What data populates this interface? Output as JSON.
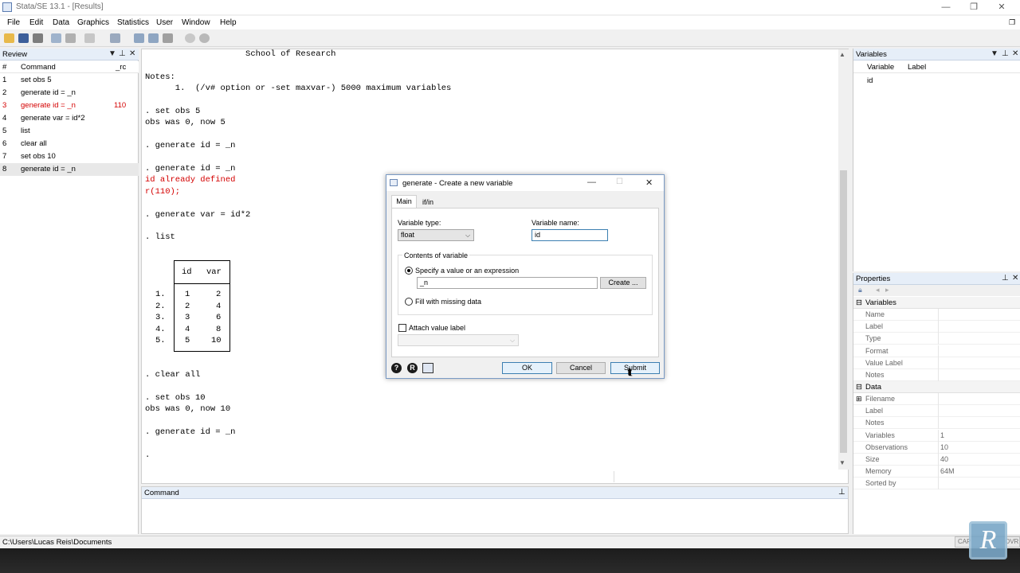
{
  "window": {
    "title": "Stata/SE 13.1 - [Results]",
    "controls": {
      "minimize": "—",
      "restore": "❐",
      "close": "✕"
    }
  },
  "menu": [
    "File",
    "Edit",
    "Data",
    "Graphics",
    "Statistics",
    "User",
    "Window",
    "Help"
  ],
  "review": {
    "title": "Review",
    "col_num": "#",
    "col_command": "Command",
    "col_rc": "_rc",
    "rows": [
      {
        "num": "1",
        "command": "set obs 5",
        "rc": ""
      },
      {
        "num": "2",
        "command": "generate id = _n",
        "rc": ""
      },
      {
        "num": "3",
        "command": "generate id = _n",
        "rc": "110"
      },
      {
        "num": "4",
        "command": "generate var = id*2",
        "rc": ""
      },
      {
        "num": "5",
        "command": "list",
        "rc": ""
      },
      {
        "num": "6",
        "command": "clear all",
        "rc": ""
      },
      {
        "num": "7",
        "command": "set obs 10",
        "rc": ""
      },
      {
        "num": "8",
        "command": "generate id = _n",
        "rc": ""
      }
    ]
  },
  "results": {
    "lines": [
      "                    School of Research",
      "",
      "Notes:",
      "      1.  (/v# option or -set maxvar-) 5000 maximum variables",
      "",
      ". set obs 5",
      "obs was 0, now 5",
      "",
      ". generate id = _n",
      "",
      ". generate id = _n",
      "id already defined",
      "r(110);",
      "",
      ". generate var = id*2",
      "",
      ". list"
    ],
    "list_header": [
      "id",
      "var"
    ],
    "list_rows": [
      {
        "obs": "1.",
        "id": "1",
        "var": "2"
      },
      {
        "obs": "2.",
        "id": "2",
        "var": "4"
      },
      {
        "obs": "3.",
        "id": "3",
        "var": "6"
      },
      {
        "obs": "4.",
        "id": "4",
        "var": "8"
      },
      {
        "obs": "5.",
        "id": "5",
        "var": "10"
      }
    ],
    "tail_lines": [
      ". clear all",
      "",
      ". set obs 10",
      "obs was 0, now 10",
      "",
      ". generate id = _n",
      "",
      "."
    ]
  },
  "command_pane": {
    "title": "Command"
  },
  "variables": {
    "title": "Variables",
    "col_variable": "Variable",
    "col_label": "Label",
    "rows": [
      {
        "name": "id",
        "label": ""
      }
    ]
  },
  "properties": {
    "title": "Properties",
    "variables_section": "Variables",
    "variables_fields": [
      {
        "label": "Name",
        "value": ""
      },
      {
        "label": "Label",
        "value": ""
      },
      {
        "label": "Type",
        "value": ""
      },
      {
        "label": "Format",
        "value": ""
      },
      {
        "label": "Value Label",
        "value": ""
      },
      {
        "label": "Notes",
        "value": ""
      }
    ],
    "data_section": "Data",
    "data_fields": [
      {
        "label": "Filename",
        "value": ""
      },
      {
        "label": "Label",
        "value": ""
      },
      {
        "label": "Notes",
        "value": ""
      },
      {
        "label": "Variables",
        "value": "1"
      },
      {
        "label": "Observations",
        "value": "10"
      },
      {
        "label": "Size",
        "value": "40"
      },
      {
        "label": "Memory",
        "value": "64M"
      },
      {
        "label": "Sorted by",
        "value": ""
      }
    ]
  },
  "statusbar": {
    "path": "C:\\Users\\Lucas Reis\\Documents",
    "caps": "CAP",
    "ovr": "OVR"
  },
  "dialog": {
    "title": "generate - Create a new variable",
    "tabs": [
      "Main",
      "if/in"
    ],
    "variable_type_label": "Variable type:",
    "variable_type_value": "float",
    "variable_name_label": "Variable name:",
    "variable_name_value": "id",
    "contents_label": "Contents of variable",
    "option_expression": "Specify a value or an expression",
    "expression_value": "_n",
    "create_button": "Create ...",
    "option_missing": "Fill with missing data",
    "attach_label": "Attach value label",
    "ok_button": "OK",
    "cancel_button": "Cancel",
    "submit_button": "Submit"
  },
  "watermark": "R"
}
